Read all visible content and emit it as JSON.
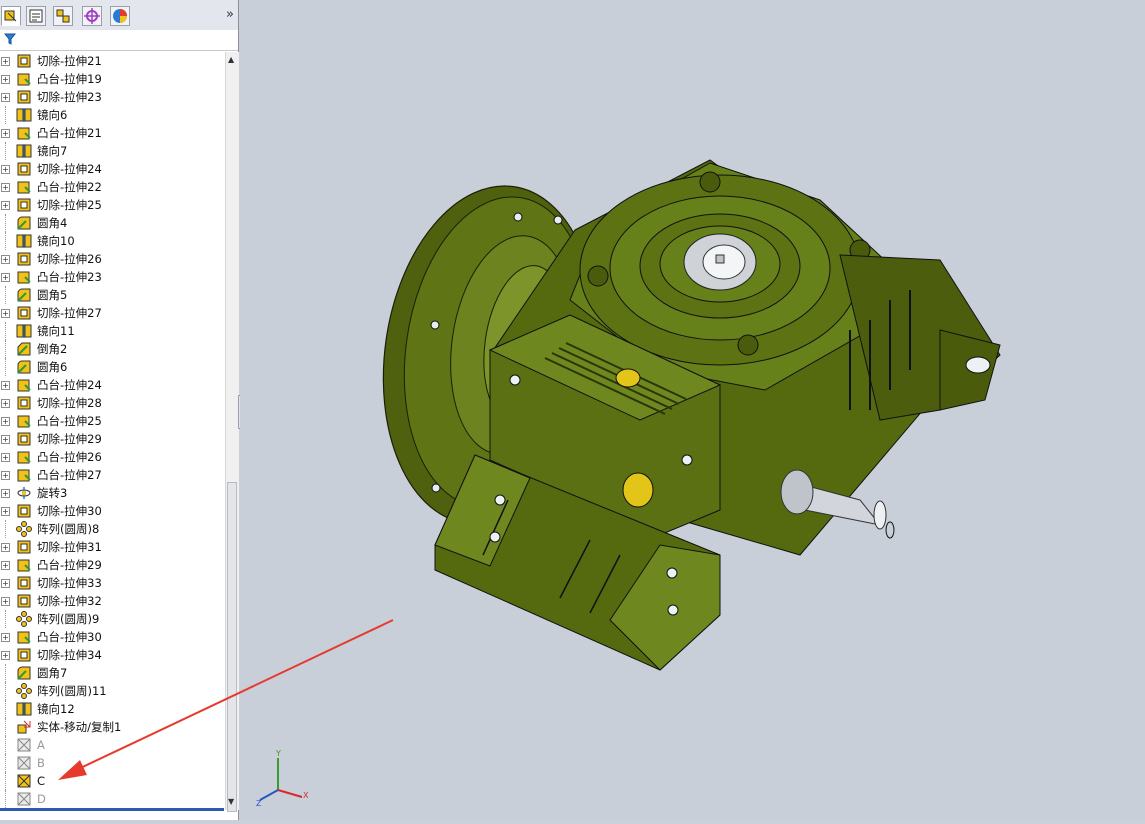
{
  "feature_tree": {
    "items": [
      {
        "label": "切除-拉伸21",
        "icon": "cut-extrude-icon",
        "expandable": true
      },
      {
        "label": "凸台-拉伸19",
        "icon": "boss-extrude-icon",
        "expandable": true
      },
      {
        "label": "切除-拉伸23",
        "icon": "cut-extrude-icon",
        "expandable": true
      },
      {
        "label": "镜向6",
        "icon": "mirror-icon",
        "expandable": false
      },
      {
        "label": "凸台-拉伸21",
        "icon": "boss-extrude-icon",
        "expandable": true
      },
      {
        "label": "镜向7",
        "icon": "mirror-icon",
        "expandable": false
      },
      {
        "label": "切除-拉伸24",
        "icon": "cut-extrude-icon",
        "expandable": true
      },
      {
        "label": "凸台-拉伸22",
        "icon": "boss-extrude-icon",
        "expandable": true
      },
      {
        "label": "切除-拉伸25",
        "icon": "cut-extrude-icon",
        "expandable": true
      },
      {
        "label": "圆角4",
        "icon": "fillet-icon",
        "expandable": false
      },
      {
        "label": "镜向10",
        "icon": "mirror-icon",
        "expandable": false
      },
      {
        "label": "切除-拉伸26",
        "icon": "cut-extrude-icon",
        "expandable": true
      },
      {
        "label": "凸台-拉伸23",
        "icon": "boss-extrude-icon",
        "expandable": true
      },
      {
        "label": "圆角5",
        "icon": "fillet-icon",
        "expandable": false
      },
      {
        "label": "切除-拉伸27",
        "icon": "cut-extrude-icon",
        "expandable": true
      },
      {
        "label": "镜向11",
        "icon": "mirror-icon",
        "expandable": false
      },
      {
        "label": "倒角2",
        "icon": "chamfer-icon",
        "expandable": false
      },
      {
        "label": "圆角6",
        "icon": "fillet-icon",
        "expandable": false
      },
      {
        "label": "凸台-拉伸24",
        "icon": "boss-extrude-icon",
        "expandable": true
      },
      {
        "label": "切除-拉伸28",
        "icon": "cut-extrude-icon",
        "expandable": true
      },
      {
        "label": "凸台-拉伸25",
        "icon": "boss-extrude-icon",
        "expandable": true
      },
      {
        "label": "切除-拉伸29",
        "icon": "cut-extrude-icon",
        "expandable": true
      },
      {
        "label": "凸台-拉伸26",
        "icon": "boss-extrude-icon",
        "expandable": true
      },
      {
        "label": "凸台-拉伸27",
        "icon": "boss-extrude-icon",
        "expandable": true
      },
      {
        "label": "旋转3",
        "icon": "revolve-icon",
        "expandable": true
      },
      {
        "label": "切除-拉伸30",
        "icon": "cut-extrude-icon",
        "expandable": true
      },
      {
        "label": "阵列(圆周)8",
        "icon": "circular-pattern-icon",
        "expandable": false
      },
      {
        "label": "切除-拉伸31",
        "icon": "cut-extrude-icon",
        "expandable": true
      },
      {
        "label": "凸台-拉伸29",
        "icon": "boss-extrude-icon",
        "expandable": true
      },
      {
        "label": "切除-拉伸33",
        "icon": "cut-extrude-icon",
        "expandable": true
      },
      {
        "label": "切除-拉伸32",
        "icon": "cut-extrude-icon",
        "expandable": true
      },
      {
        "label": "阵列(圆周)9",
        "icon": "circular-pattern-icon",
        "expandable": false
      },
      {
        "label": "凸台-拉伸30",
        "icon": "boss-extrude-icon",
        "expandable": true
      },
      {
        "label": "切除-拉伸34",
        "icon": "cut-extrude-icon",
        "expandable": true
      },
      {
        "label": "圆角7",
        "icon": "fillet-icon",
        "expandable": false
      },
      {
        "label": "阵列(圆周)11",
        "icon": "circular-pattern-icon",
        "expandable": false
      },
      {
        "label": "镜向12",
        "icon": "mirror-icon",
        "expandable": false
      },
      {
        "label": "实体-移动/复制1",
        "icon": "move-copy-body-icon",
        "expandable": false
      },
      {
        "label": "A",
        "icon": "suppressed-feature-icon",
        "expandable": false,
        "dim": true
      },
      {
        "label": "B",
        "icon": "suppressed-feature-icon",
        "expandable": false,
        "dim": true
      },
      {
        "label": "C",
        "icon": "feature-icon",
        "expandable": false,
        "dim": false
      },
      {
        "label": "D",
        "icon": "suppressed-feature-icon",
        "expandable": false,
        "dim": true
      }
    ]
  },
  "triad": {
    "x": "X",
    "y": "Y",
    "z": "Z"
  },
  "colors": {
    "model": "#5a6e13",
    "model_dark": "#3e4d0a",
    "model_light": "#74891f",
    "background": "#c9cfd9",
    "arrow": "#e63a2e"
  }
}
